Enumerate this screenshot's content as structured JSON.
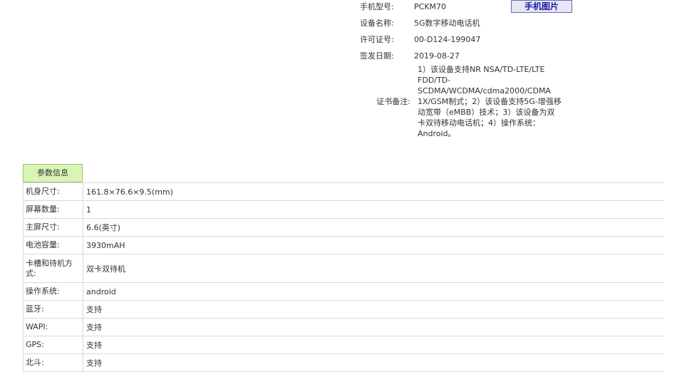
{
  "certificate": {
    "model_label": "手机型号:",
    "model_value": "PCKM70",
    "phone_image_button": "手机图片",
    "name_label": "设备名称:",
    "name_value": "5G数字移动电话机",
    "license_label": "许可证号:",
    "license_value": "00-D124-199047",
    "date_label": "签发日期:",
    "date_value": "2019-08-27",
    "note_label": "证书备注:",
    "note_lines": [
      "1）该设备支持NR NSA/TD-LTE/LTE",
      "FDD/TD-",
      "SCDMA/WCDMA/cdma2000/CDMA",
      "1X/GSM制式；2）该设备支持5G-增强移",
      "动宽带（eMBB）技术；3）该设备为双",
      "卡双待移动电话机；4）操作系统：",
      "Android。"
    ]
  },
  "params": {
    "tab_label": "参数信息",
    "rows": [
      {
        "key": "机身尺寸:",
        "value": "161.8×76.6×9.5(mm)"
      },
      {
        "key": "屏幕数量:",
        "value": "1"
      },
      {
        "key": "主屏尺寸:",
        "value": "6.6(英寸)"
      },
      {
        "key": "电池容量:",
        "value": "3930mAH"
      },
      {
        "key_lines": [
          "卡槽和待机方",
          "式:"
        ],
        "value": "双卡双待机"
      },
      {
        "key": "操作系统:",
        "value": "android"
      },
      {
        "key": "蓝牙:",
        "value": "支持"
      },
      {
        "key": "WAPI:",
        "value": "支持"
      },
      {
        "key": "GPS:",
        "value": "支持"
      },
      {
        "key": "北斗:",
        "value": "支持"
      }
    ]
  }
}
